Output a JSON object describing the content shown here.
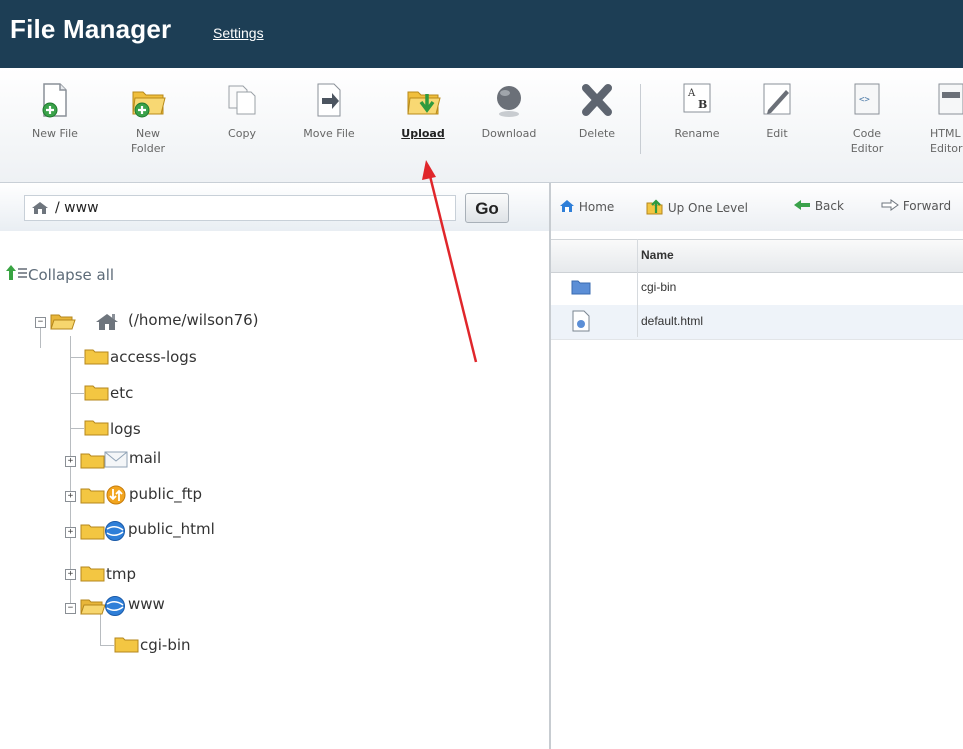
{
  "header": {
    "title": "File Manager",
    "settings_label": "Settings"
  },
  "toolbar": {
    "new_file": "New File",
    "new_folder": "New Folder",
    "copy": "Copy",
    "move_file": "Move File",
    "upload": "Upload",
    "download": "Download",
    "delete": "Delete",
    "rename": "Rename",
    "edit": "Edit",
    "code_editor": "Code Editor",
    "html_editor": "HTML Editor"
  },
  "path_bar": {
    "value": "/ www",
    "go_label": "Go"
  },
  "tree": {
    "collapse_label": "Collapse all",
    "root_label": "(/home/wilson76)",
    "items": [
      "access-logs",
      "etc",
      "logs",
      "mail",
      "public_ftp",
      "public_html",
      "tmp",
      "www",
      "cgi-bin"
    ]
  },
  "nav": {
    "home": "Home",
    "up": "Up One Level",
    "back": "Back",
    "forward": "Forward"
  },
  "files": {
    "header_name": "Name",
    "rows": [
      "cgi-bin",
      "default.html"
    ]
  },
  "colors": {
    "header_bg": "#1d3e55",
    "arrow": "#e0262b",
    "folder": "#f5c542"
  }
}
